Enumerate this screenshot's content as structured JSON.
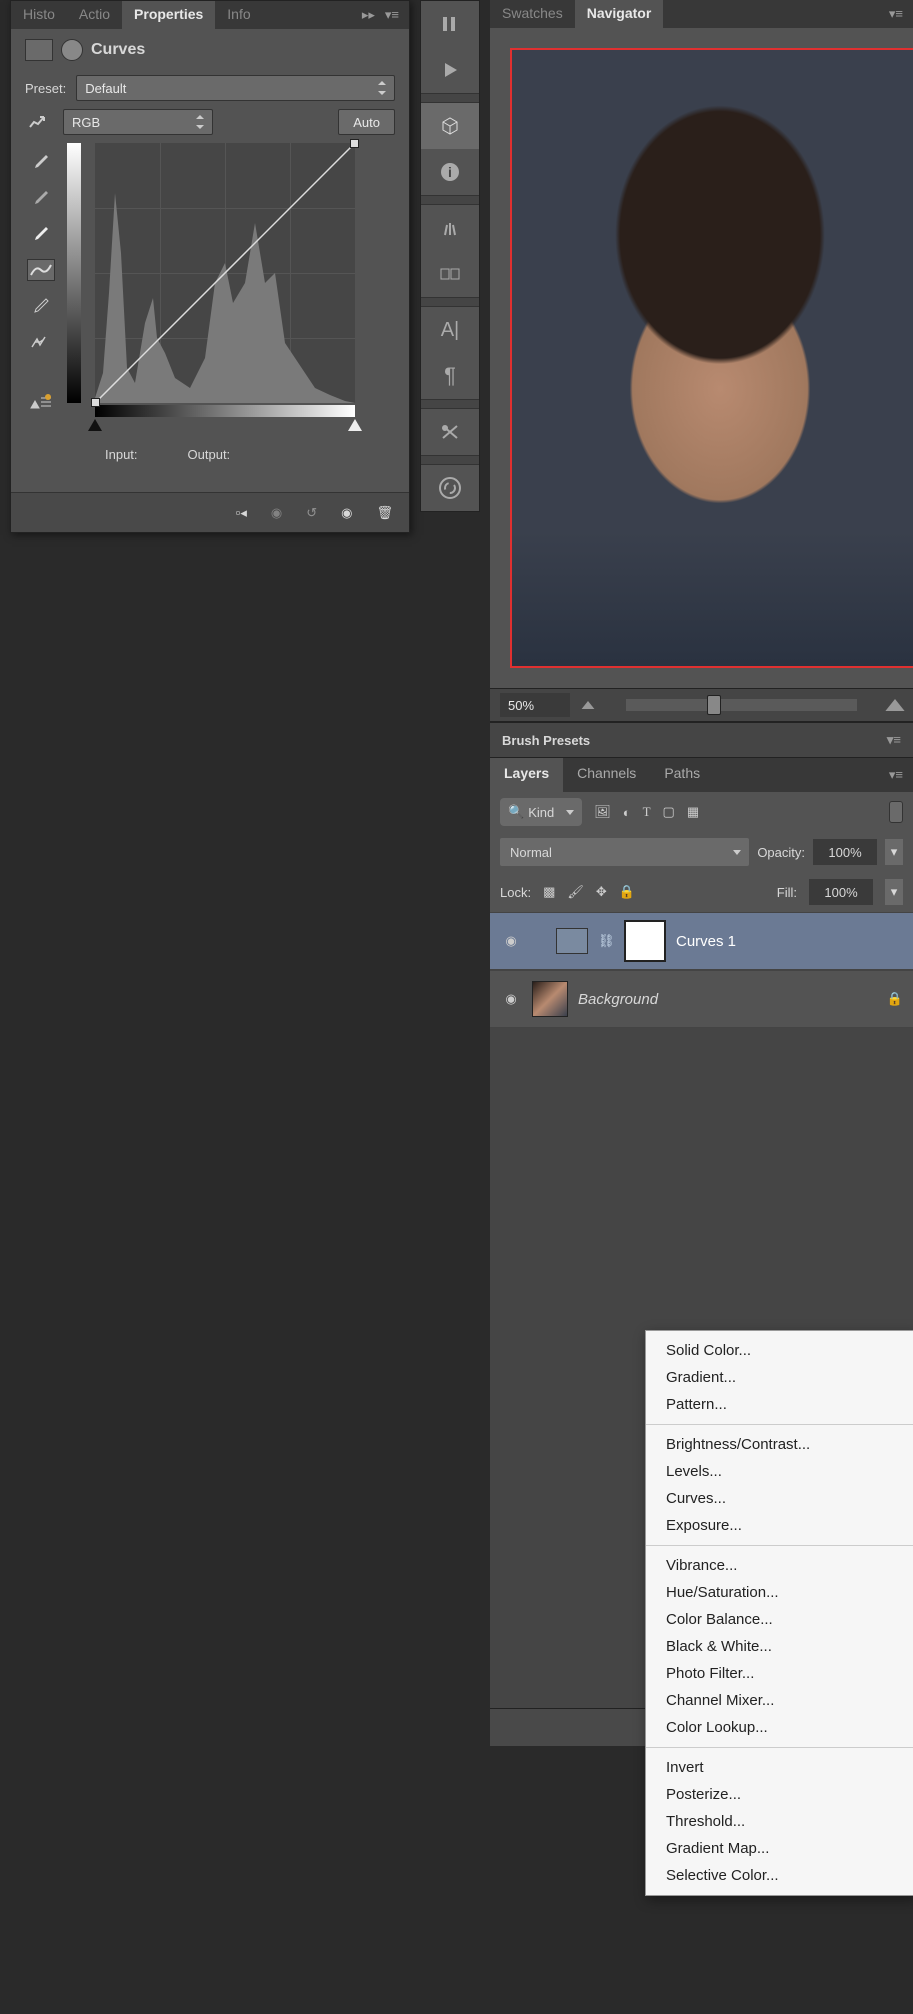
{
  "props": {
    "tabs": [
      "Histo",
      "Actio",
      "Properties",
      "Info"
    ],
    "active_tab": "Properties",
    "title": "Curves",
    "preset_label": "Preset:",
    "preset_value": "Default",
    "channel": "RGB",
    "auto": "Auto",
    "input_label": "Input:",
    "output_label": "Output:"
  },
  "nav": {
    "tabs": [
      "Swatches",
      "Navigator"
    ],
    "active": "Navigator",
    "zoom": "50%"
  },
  "brush": {
    "title": "Brush Presets"
  },
  "layers": {
    "tabs": [
      "Layers",
      "Channels",
      "Paths"
    ],
    "active": "Layers",
    "kind": "Kind",
    "blend": "Normal",
    "opacity_label": "Opacity:",
    "opacity": "100%",
    "lock_label": "Lock:",
    "fill_label": "Fill:",
    "fill": "100%",
    "items": [
      {
        "name": "Curves 1"
      },
      {
        "name": "Background"
      }
    ]
  },
  "menu": {
    "g1": [
      "Solid Color...",
      "Gradient...",
      "Pattern..."
    ],
    "g2": [
      "Brightness/Contrast...",
      "Levels...",
      "Curves...",
      "Exposure..."
    ],
    "g3": [
      "Vibrance...",
      "Hue/Saturation...",
      "Color Balance...",
      "Black & White...",
      "Photo Filter...",
      "Channel Mixer...",
      "Color Lookup..."
    ],
    "g4": [
      "Invert",
      "Posterize...",
      "Threshold...",
      "Gradient Map...",
      "Selective Color..."
    ]
  }
}
